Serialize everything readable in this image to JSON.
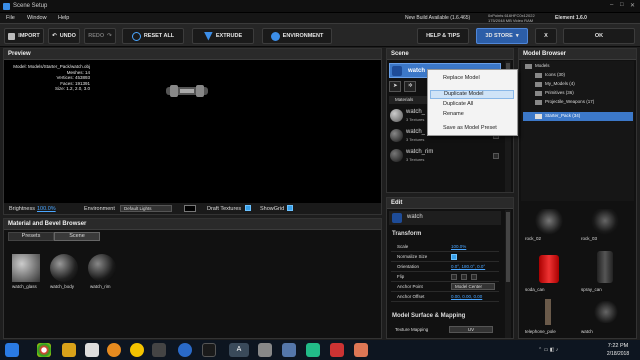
{
  "window": {
    "title": "Scene Setup",
    "build_info": "0xPoints 616HFC0x12022\n175/2048 MB Video RAM",
    "update_link": "New Build Available (1.6.465)",
    "element_version": "Element 1.6.0"
  },
  "menu": [
    "File",
    "Window",
    "Help"
  ],
  "toolbar": {
    "import": "IMPORT",
    "undo": "UNDO",
    "redo": "REDO",
    "reset_all": "RESET ALL",
    "extrude": "EXTRUDE",
    "environment": "ENVIRONMENT",
    "help_tips": "HELP & TIPS",
    "store": "3D STORE",
    "cancel": "X",
    "ok": "OK"
  },
  "preview": {
    "title": "Preview",
    "info": {
      "model": "Model: Models/Starter_Pack/watch.obj",
      "meshes": "Meshes: 14",
      "vertices": "Vertices: 453893",
      "faces": "Faces: 191391",
      "size": "Size: 1.2, 2.0, 3.0"
    },
    "bar": {
      "brightness_label": "Brightness",
      "brightness_value": "100.0%",
      "environment_label": "Environment",
      "environment_value": "Default Lights",
      "draft_textures": "Draft Textures",
      "show_grid": "ShowGrid"
    }
  },
  "material_browser": {
    "title": "Material and Bevel Browser",
    "tabs": [
      "Presets",
      "Scene"
    ],
    "items": [
      "watch_glass",
      "watch_body",
      "watch_rim"
    ]
  },
  "scene": {
    "title": "Scene",
    "selected": "watch",
    "close": "x",
    "materials_label": "Materials",
    "materials": [
      {
        "name": "watch_",
        "sub": "3 Textures"
      },
      {
        "name": "watch_",
        "sub": "3 Textures"
      },
      {
        "name": "watch_rim",
        "sub": "3 Textures"
      }
    ]
  },
  "context_menu": {
    "items": [
      "Replace Model",
      "Duplicate Model",
      "Duplicate All",
      "Rename",
      "Save as Model Preset"
    ]
  },
  "edit": {
    "title": "Edit",
    "item": "watch",
    "transform_title": "Transform",
    "rows": [
      {
        "label": "Scale",
        "value": "100.0%"
      },
      {
        "label": "Normalize Size",
        "value": ""
      },
      {
        "label": "Orientation",
        "value": "0.0°, 180.0°, 0.0°"
      },
      {
        "label": "Flip",
        "value": ""
      },
      {
        "label": "Anchor Point",
        "value": "Model Center"
      },
      {
        "label": "Anchor Offset",
        "value": "0.00, 0.00, 0.00"
      }
    ],
    "surface_title": "Model Surface & Mapping",
    "texture_mapping_label": "Texture Mapping",
    "texture_mapping_value": "UV"
  },
  "model_browser": {
    "title": "Model Browser",
    "tree": [
      {
        "label": "Models",
        "level": 0
      },
      {
        "label": "Icons (30)",
        "level": 1
      },
      {
        "label": "My_Models (4)",
        "level": 1
      },
      {
        "label": "Primitives (36)",
        "level": 1
      },
      {
        "label": "Projectile_Weapons (17)",
        "level": 1
      },
      {
        "label": "Starter_Pack (34)",
        "level": 1
      }
    ],
    "thumbs": [
      "rock_02",
      "rock_03",
      "soda_can",
      "spray_can",
      "telephone_pole",
      "watch"
    ]
  },
  "taskbar": {
    "time": "7:22 PM",
    "date": "2/18/2018"
  },
  "colors": {
    "accent_blue": "#2c5ea8",
    "highlight": "#3c78c8",
    "link": "#4aa6ff"
  }
}
